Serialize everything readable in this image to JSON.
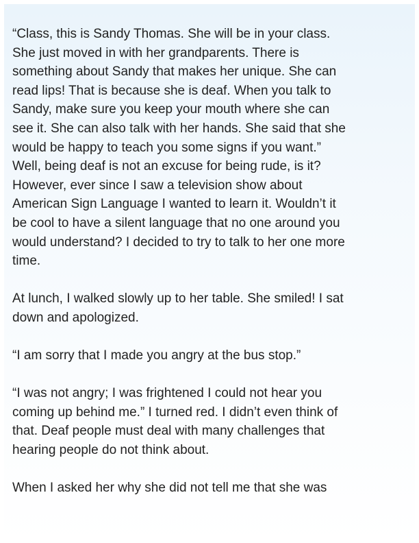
{
  "story": {
    "p1": [
      "“Class, this is Sandy Thomas. She will be in your class.",
      "She just moved in with her grandparents. There is",
      "something about Sandy that makes her unique. She can",
      "read lips! That is because she is deaf. When you talk to",
      "Sandy, make sure you keep your mouth where she can",
      "see it. She can also talk with her hands. She said that she",
      "would be happy to teach you some signs if you want.”",
      "Well, being deaf is not an excuse for being rude, is it?",
      "However, ever since I saw a television show about",
      "American Sign Language I wanted to learn it. Wouldn’t it",
      "be cool to have a silent language that no one around you",
      "would understand? I decided to try to talk to her one more",
      "time."
    ],
    "p2": [
      "At lunch, I walked slowly up to her table. She smiled! I sat",
      "down and apologized."
    ],
    "p3": [
      "“I am sorry that I made you angry at the bus stop.”"
    ],
    "p4": [
      "“I was not angry; I was frightened I could not hear you",
      "coming up behind me.” I turned red.  I didn’t even think of",
      "that. Deaf people must deal with many challenges that",
      "hearing people do not think about."
    ],
    "p5": [
      "When I asked her why she did not tell me that she was"
    ]
  }
}
